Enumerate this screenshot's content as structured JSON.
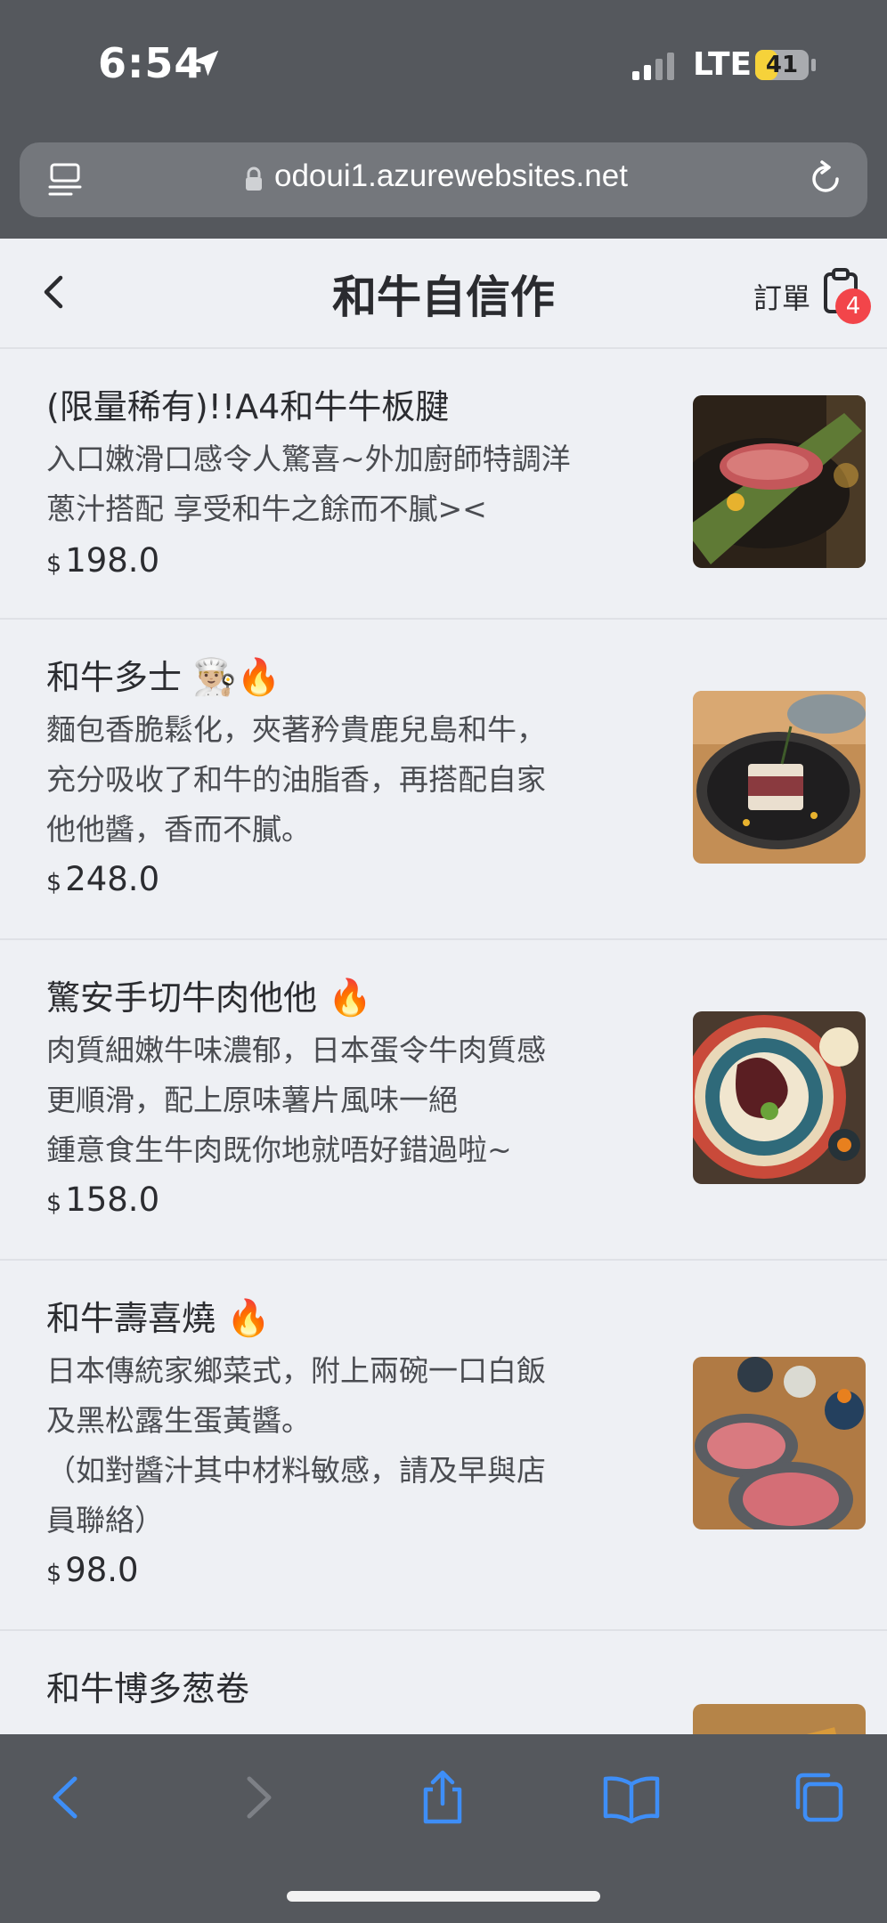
{
  "status_bar": {
    "time": "6:54",
    "carrier": "LTE",
    "battery": "41",
    "battery_level": 0.41
  },
  "browser": {
    "url": "odoui1.azurewebsites.net"
  },
  "header": {
    "title": "和牛自信作",
    "order_label": "訂單",
    "order_count": "4"
  },
  "menu": {
    "currency": "$",
    "items": [
      {
        "name": "(限量稀有)!!A4和牛牛板腱",
        "description": "入口嫩滑口感令人驚喜~外加廚師特調洋\n蔥汁搭配 享受和牛之餘而不膩><",
        "price": "198.0"
      },
      {
        "name": "和牛多士",
        "emoji": "👨🏼‍🍳🔥",
        "description": "麵包香脆鬆化，夾著矜貴鹿兒島和牛，\n充分吸收了和牛的油脂香，再搭配自家\n他他醬，香而不膩。",
        "price": "248.0"
      },
      {
        "name": "驚安手切牛肉他他",
        "emoji": "🔥",
        "description": "肉質細嫩牛味濃郁，日本蛋令牛肉質感\n更順滑，配上原味薯片風味一絕\n鍾意食生牛肉既你地就唔好錯過啦~",
        "price": "158.0"
      },
      {
        "name": "和牛壽喜燒",
        "emoji": "🔥",
        "description": "日本傳統家鄉菜式，附上兩碗一口白飯\n及黑松露生蛋黃醬。\n（如對醬汁其中材料敏感，請及早與店\n員聯絡）",
        "price": "98.0"
      },
      {
        "name": "和牛博多葱卷",
        "description": "",
        "price": ""
      }
    ]
  },
  "colors": {
    "chrome": "#55585d",
    "url_field": "#74777c",
    "accent_blue": "#3e8ef7",
    "badge_red": "#f2454a",
    "battery_yellow": "#f6d23a"
  }
}
